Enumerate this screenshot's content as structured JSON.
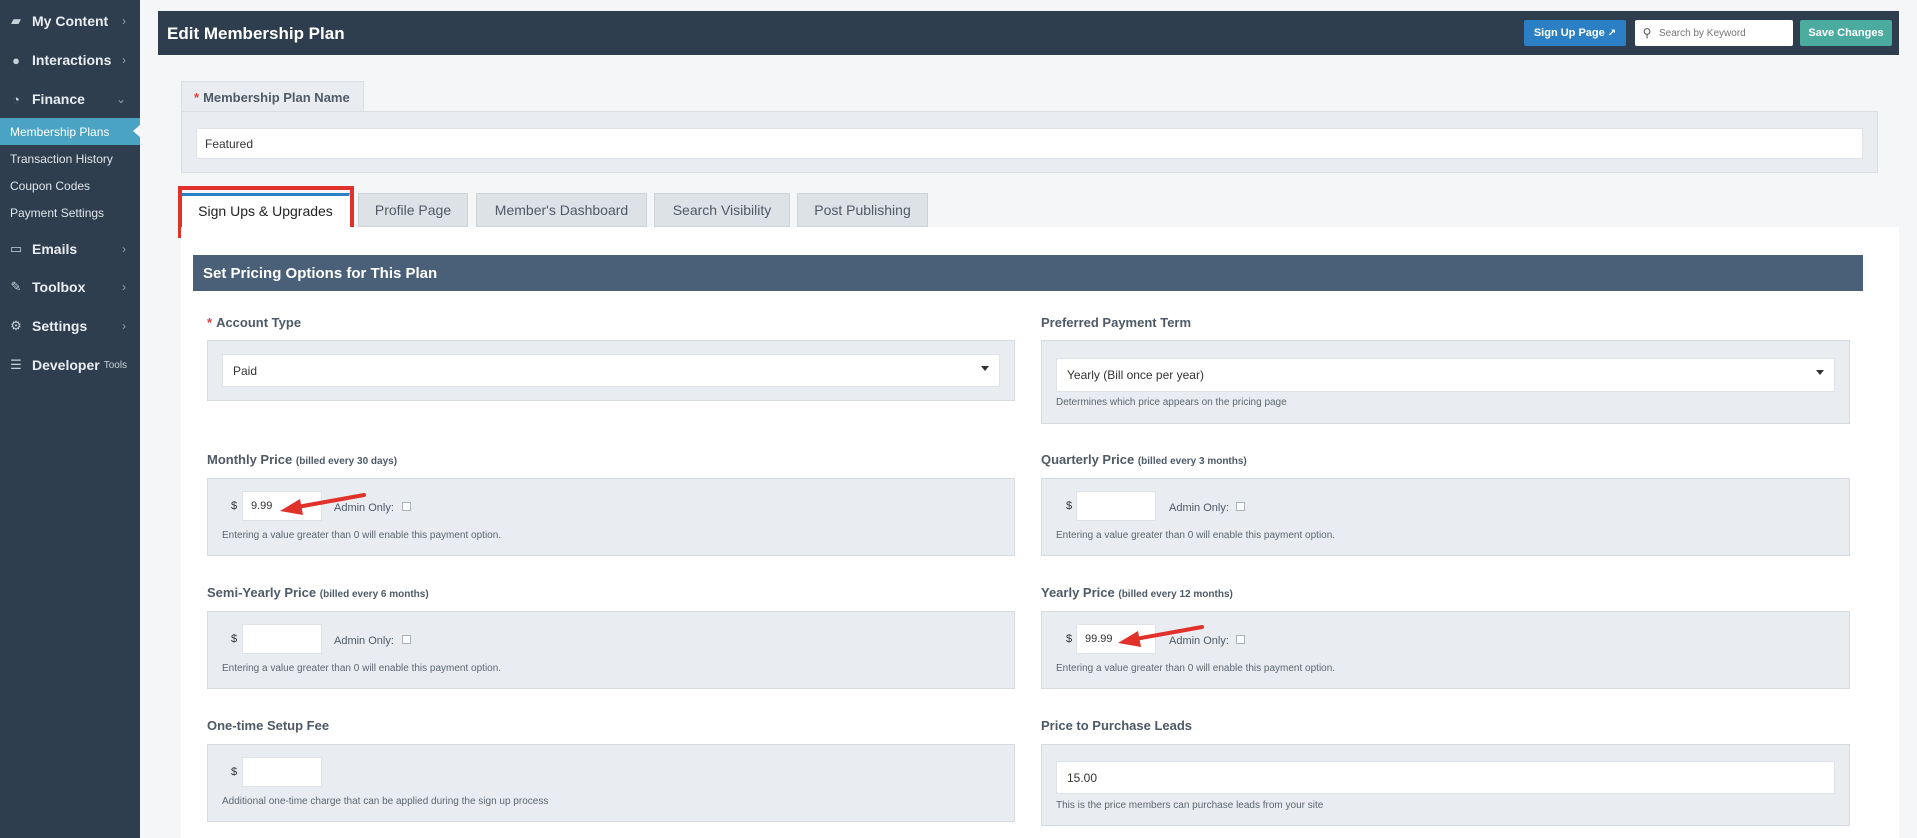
{
  "sidebar": {
    "items": [
      {
        "label": "My Content",
        "icon": "folder-icon"
      },
      {
        "label": "Interactions",
        "icon": "chat-icon"
      },
      {
        "label": "Finance",
        "icon": "pie-chart-icon"
      },
      {
        "label": "Emails",
        "icon": "inbox-icon"
      },
      {
        "label": "Toolbox",
        "icon": "wrench-icon"
      },
      {
        "label": "Settings",
        "icon": "gear-icon"
      },
      {
        "label": "Developer",
        "suffix": "Tools",
        "icon": "sliders-icon"
      }
    ],
    "finance_sub": [
      {
        "label": "Membership Plans",
        "active": true
      },
      {
        "label": "Transaction History"
      },
      {
        "label": "Coupon Codes"
      },
      {
        "label": "Payment Settings"
      }
    ]
  },
  "header": {
    "title": "Edit Membership Plan",
    "signup_label": "Sign Up Page",
    "search_placeholder": "Search by Keyword",
    "save_label": "Save Changes"
  },
  "plan_name": {
    "label": "Membership Plan Name",
    "required": "*",
    "value": "Featured"
  },
  "tabs": [
    {
      "label": "Sign Ups & Upgrades",
      "active": true
    },
    {
      "label": "Profile Page"
    },
    {
      "label": "Member's Dashboard"
    },
    {
      "label": "Search Visibility"
    },
    {
      "label": "Post Publishing"
    }
  ],
  "section_title": "Set Pricing Options for This Plan",
  "fields": {
    "account_type": {
      "label": "Account Type",
      "required": "*",
      "value": "Paid"
    },
    "payment_term": {
      "label": "Preferred Payment Term",
      "value": "Yearly (Bill once per year)",
      "help": "Determines which price appears on the pricing page"
    },
    "monthly": {
      "label": "Monthly Price",
      "sub": "(billed every 30 days)",
      "currency": "$",
      "value": "9.99",
      "admin_label": "Admin Only:",
      "admin_checked": false,
      "help": "Entering a value greater than 0 will enable this payment option."
    },
    "quarterly": {
      "label": "Quarterly Price",
      "sub": "(billed every 3 months)",
      "currency": "$",
      "value": "",
      "admin_label": "Admin Only:",
      "admin_checked": false,
      "help": "Entering a value greater than 0 will enable this payment option."
    },
    "semiyearly": {
      "label": "Semi-Yearly Price",
      "sub": "(billed every 6 months)",
      "currency": "$",
      "value": "",
      "admin_label": "Admin Only:",
      "admin_checked": false,
      "help": "Entering a value greater than 0 will enable this payment option."
    },
    "yearly": {
      "label": "Yearly Price",
      "sub": "(billed every 12 months)",
      "currency": "$",
      "value": "99.99",
      "admin_label": "Admin Only:",
      "admin_checked": false,
      "help": "Entering a value greater than 0 will enable this payment option."
    },
    "setup_fee": {
      "label": "One-time Setup Fee",
      "currency": "$",
      "value": "",
      "help": "Additional one-time charge that can be applied during the sign up process"
    },
    "leads_price": {
      "label": "Price to Purchase Leads",
      "value": "15.00",
      "help": "This is the price members can purchase leads from your site"
    }
  },
  "colors": {
    "sidebar_bg": "#2e3e4e",
    "active_sub": "#4aa3c3",
    "section_bar": "#4a6078",
    "signup_btn": "#2b80c5",
    "save_btn": "#4bab9e",
    "annotation_red": "#e0312a"
  }
}
